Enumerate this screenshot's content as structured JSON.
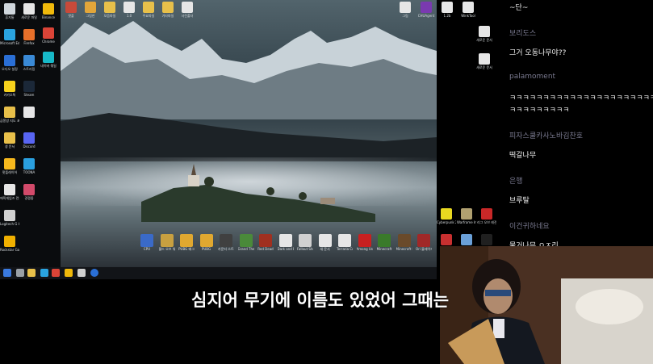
{
  "desktop_icons_left": [
    {
      "label": "휴지통",
      "icon": "recycle-bin-icon",
      "color": "#cfd6dc"
    },
    {
      "label": "Microsoft Edge",
      "icon": "edge-icon",
      "color": "#2aa4e0"
    },
    {
      "label": "오디오 설정",
      "icon": "audio-icon",
      "color": "#2a6fd6"
    },
    {
      "label": "카카오톡",
      "icon": "kakaotalk-icon",
      "color": "#f7d21c"
    },
    {
      "label": "금퐁방 지도 포함",
      "icon": "folder-icon",
      "color": "#e8c04a"
    },
    {
      "label": "생 문서",
      "icon": "folder-icon",
      "color": "#e8c04a"
    },
    {
      "label": "팟플레이어",
      "icon": "potplayer-icon",
      "color": "#f5b81d"
    },
    {
      "label": "에픽게임즈 런처",
      "icon": "doc-icon",
      "color": "#e6e6e6"
    },
    {
      "label": "Logitech G Hub",
      "icon": "logitech-icon",
      "color": "#d0d0d0"
    },
    {
      "label": "Rockstar Games",
      "icon": "rockstar-icon",
      "color": "#f0b000"
    }
  ],
  "desktop_icons_left2": [
    {
      "label": "새로운 파일",
      "icon": "doc-icon",
      "color": "#e6e6e6"
    },
    {
      "label": "Firefox",
      "icon": "firefox-icon",
      "color": "#e8702a"
    },
    {
      "label": "스트리밍",
      "icon": "app-icon",
      "color": "#3a8ad6"
    },
    {
      "label": "Steam",
      "icon": "steam-icon",
      "color": "#1b2838"
    },
    {
      "label": "",
      "icon": "doc-icon",
      "color": "#e6e6e6"
    },
    {
      "label": "Discord",
      "icon": "discord-icon",
      "color": "#5865f2"
    },
    {
      "label": "TOONA",
      "icon": "toona-icon",
      "color": "#2aa0e0"
    },
    {
      "label": "경쟁중",
      "icon": "app-icon",
      "color": "#d24a6a"
    }
  ],
  "desktop_icons_left3": [
    {
      "label": "Binance",
      "icon": "binance-icon",
      "color": "#f0b90b"
    },
    {
      "label": "Chrome",
      "icon": "chrome-icon",
      "color": "#db4437"
    },
    {
      "label": "네이버 웨일",
      "icon": "whale-icon",
      "color": "#17b9c8"
    }
  ],
  "desktop_icons_top": [
    {
      "label": "팟플",
      "icon": "app-icon",
      "color": "#c84a3a"
    },
    {
      "label": "그림판",
      "icon": "paint-icon",
      "color": "#e2a63a"
    },
    {
      "label": "모음파일",
      "icon": "folder-icon",
      "color": "#e8c04a"
    },
    {
      "label": "1.0",
      "icon": "doc-icon",
      "color": "#e6e6e6"
    },
    {
      "label": "주요파일",
      "icon": "folder-icon",
      "color": "#e8c04a"
    },
    {
      "label": "기타파일",
      "icon": "folder-icon",
      "color": "#e8c04a"
    },
    {
      "label": "사진폴더",
      "icon": "doc-icon",
      "color": "#e6e6e6"
    }
  ],
  "desktop_icons_right_top": [
    {
      "label": "그림",
      "icon": "doc-icon",
      "color": "#e6e6e6"
    },
    {
      "label": "CHUAgent",
      "icon": "app-icon",
      "color": "#7a3ab0"
    },
    {
      "label": "1.2b",
      "icon": "doc-icon",
      "color": "#e6e6e6"
    },
    {
      "label": "WinkTool",
      "icon": "doc-icon",
      "color": "#e6e6e6"
    }
  ],
  "desktop_icons_right_col": [
    {
      "label": "새로운 문서",
      "icon": "doc-icon",
      "color": "#e6e6e6"
    },
    {
      "label": "새로운 문서",
      "icon": "doc-icon",
      "color": "#e6e6e6"
    }
  ],
  "dock_icons": [
    {
      "label": "CPU",
      "icon": "app-icon",
      "color": "#3a6ac8"
    },
    {
      "label": "월드 오브 워크래프트 클래식",
      "icon": "wow-icon",
      "color": "#c8a040"
    },
    {
      "label": "PUBG 배그",
      "icon": "pubg-icon",
      "color": "#e0a830"
    },
    {
      "label": "PUBG",
      "icon": "pubg-icon",
      "color": "#e0a830"
    },
    {
      "label": "카운터 스트라이크",
      "icon": "app-icon",
      "color": "#404040"
    },
    {
      "label": "Grand Theft Auto V",
      "icon": "gta-icon",
      "color": "#4a8a3a"
    },
    {
      "label": "Red Dead",
      "icon": "app-icon",
      "color": "#a03020"
    },
    {
      "label": "Dark and Darker",
      "icon": "doc-icon",
      "color": "#e6e6e6"
    },
    {
      "label": "Fallout Shelter",
      "icon": "app-icon",
      "color": "#d0d0d0"
    },
    {
      "label": "새 문서",
      "icon": "doc-icon",
      "color": "#e6e6e6"
    },
    {
      "label": "Terraria Crafter",
      "icon": "doc-icon",
      "color": "#e6e6e6"
    },
    {
      "label": "Among Us",
      "icon": "amongus-icon",
      "color": "#c82020"
    },
    {
      "label": "Minecraft",
      "icon": "app-icon",
      "color": "#3a7a2a"
    },
    {
      "label": "Minecraft Launcher",
      "icon": "minecraft-icon",
      "color": "#6a4a2a"
    },
    {
      "label": "Ori 블레이드",
      "icon": "app-icon",
      "color": "#a02828"
    }
  ],
  "right_bottom_icons": [
    {
      "label": "Cyberpunk 2077",
      "icon": "cyberpunk-icon",
      "color": "#e8d820"
    },
    {
      "label": "Warframe Installer",
      "icon": "app-icon",
      "color": "#b0a070"
    },
    {
      "label": "리그 오브 레전드",
      "icon": "app-icon",
      "color": "#c82828"
    },
    {
      "label": "",
      "icon": "app-icon",
      "color": "#c83030"
    },
    {
      "label": "",
      "icon": "app-icon",
      "color": "#6aa0d8"
    },
    {
      "label": "",
      "icon": "app-icon",
      "color": "#202020"
    }
  ],
  "chat": {
    "lines": [
      {
        "type": "msg",
        "text": "~단~"
      },
      {
        "type": "name",
        "text": "보리도스"
      },
      {
        "type": "msg",
        "text": "그거 오동나무야??"
      },
      {
        "type": "name",
        "text": "palamoment"
      },
      {
        "type": "msg",
        "text": "ㅋㅋㅋㅋㅋㅋㅋㅋㅋㅋㅋㅋㅋㅋㅋㅋㅋㅋㅋㅋㅋㅋㅋ"
      },
      {
        "type": "msg",
        "text": "ㅋㅋㅋㅋㅋㅋㅋㅋㅋ"
      },
      {
        "type": "name",
        "text": "피자스쿨카사노바김찬호"
      },
      {
        "type": "msg",
        "text": "떡갈나무"
      },
      {
        "type": "name",
        "text": "은행"
      },
      {
        "type": "msg",
        "text": "브루탈"
      },
      {
        "type": "name",
        "text": "이건귀하네요"
      },
      {
        "type": "msg",
        "text": "물거나무 ㅇㅈ리"
      }
    ]
  },
  "subtitle": "심지어 무기에 이름도 있었어 그때는"
}
